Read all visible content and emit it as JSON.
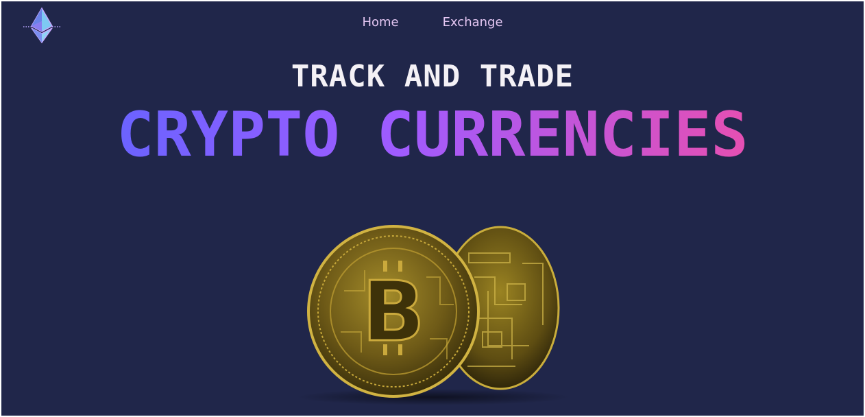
{
  "nav": {
    "logo_icon": "ethereum-icon",
    "items": [
      {
        "label": "Home"
      },
      {
        "label": "Exchange"
      }
    ]
  },
  "hero": {
    "subtitle": "TRACK AND TRADE",
    "headline": "CRYPTO CURRENCIES",
    "image_icon": "bitcoin-coins-image"
  },
  "colors": {
    "background": "#20264a",
    "nav_text": "#e3c6f2",
    "gradient_start": "#6b63ff",
    "gradient_mid": "#a05bff",
    "gradient_end": "#e64fb2",
    "coin_gold": "#9a8420"
  }
}
